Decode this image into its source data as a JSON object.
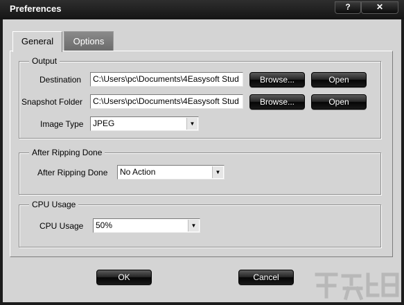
{
  "window": {
    "title": "Preferences",
    "help_label": "?",
    "close_label": "✕"
  },
  "tabs": [
    {
      "label": "General",
      "active": true
    },
    {
      "label": "Options",
      "active": false
    }
  ],
  "output": {
    "legend": "Output",
    "destination_label": "Destination",
    "destination_value": "C:\\Users\\pc\\Documents\\4Easysoft Stud",
    "snapshot_label": "Snapshot Folder",
    "snapshot_value": "C:\\Users\\pc\\Documents\\4Easysoft Stud",
    "browse_label": "Browse...",
    "open_label": "Open",
    "image_type_label": "Image Type",
    "image_type_value": "JPEG"
  },
  "after_ripping": {
    "legend": "After Ripping Done",
    "label": "After Ripping Done",
    "value": "No Action"
  },
  "cpu": {
    "legend": "CPU Usage",
    "label": "CPU Usage",
    "value": "50%"
  },
  "footer": {
    "ok_label": "OK",
    "cancel_label": "Cancel"
  },
  "colors": {
    "title_bar": "#1c1c1c",
    "client_bg": "#d4d4d4",
    "button_bg": "#1a1a1a"
  }
}
